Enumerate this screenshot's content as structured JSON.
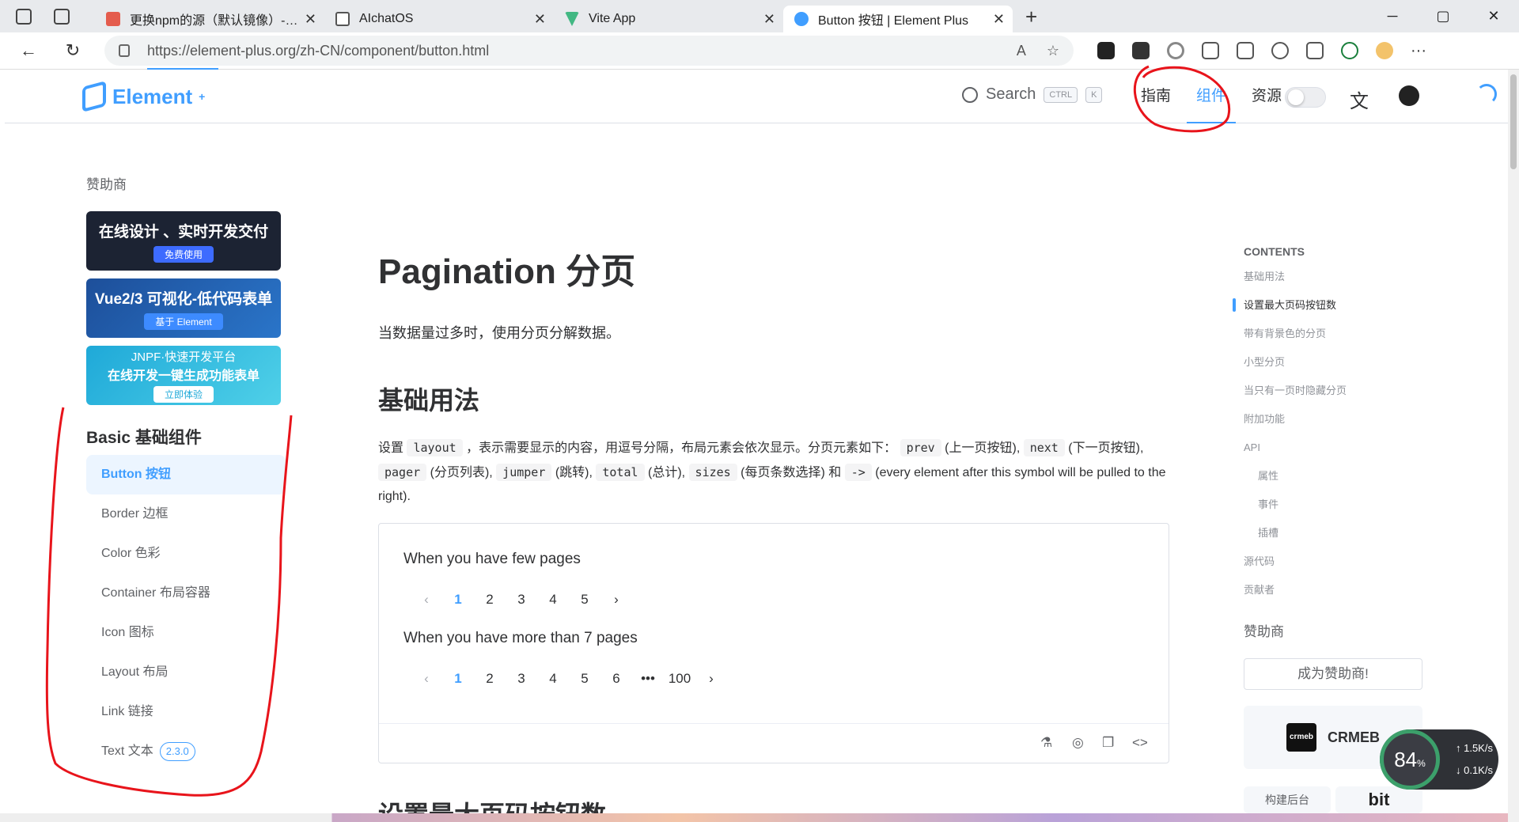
{
  "browser": {
    "tabs": [
      {
        "title": "更换npm的源（默认镜像）- 简书",
        "color": "#e45c4d"
      },
      {
        "title": "AIchatOS",
        "color": "#9aa0a6"
      },
      {
        "title": "Vite App",
        "color": "#42b883"
      },
      {
        "title": "Button 按钮 | Element Plus",
        "color": "#409eff"
      }
    ],
    "url": "https://element-plus.org/zh-CN/component/button.html",
    "win_min": "─",
    "win_max": "▢",
    "win_close": "✕"
  },
  "header": {
    "logo": "Element",
    "logo_sup": "+",
    "search_label": "Search",
    "kbd_ctrl": "CTRL",
    "kbd_k": "K",
    "nav": [
      "指南",
      "组件",
      "资源"
    ],
    "active_nav": "组件"
  },
  "sidebar": {
    "sponsor_title": "赞助商",
    "banners": [
      {
        "title": "在线设计 、实时开发交付",
        "sub": "免费使用",
        "bg": "#1c2333"
      },
      {
        "title": "Vue2/3 可视化-低代码表单",
        "sub": "基于 Element",
        "bg": "#1d4f9a"
      },
      {
        "title": "在线开发一键生成功能表单",
        "sub": "立即体验",
        "bg": "#1fa9d8",
        "top": "JNPF·快速开发平台"
      }
    ],
    "group_title": "Basic 基础组件",
    "items": [
      "Button 按钮",
      "Border 边框",
      "Color 色彩",
      "Container 布局容器",
      "Icon 图标",
      "Layout 布局",
      "Link 链接",
      "Text 文本"
    ],
    "text_badge": "2.3.0"
  },
  "main": {
    "title": "Pagination 分页",
    "intro": "当数据量过多时，使用分页分解数据。",
    "h2": "基础用法",
    "desc": {
      "p1": "设置",
      "c_layout": "layout",
      "p2": "，表示需要显示的内容，用逗号分隔，布局元素会依次显示。分页元素如下：",
      "c_prev": "prev",
      "p3": "(上一页按钮),",
      "c_next": "next",
      "p4": "(下一页按钮),",
      "c_pager": "pager",
      "p5": "(分页列表),",
      "c_jumper": "jumper",
      "p6": "(跳转),",
      "c_total": "total",
      "p7": "(总计),",
      "c_sizes": "sizes",
      "p8": "(每页条数选择) 和",
      "c_arrow": "->",
      "p9": "(every element after this symbol will be pulled to the right)."
    },
    "demo1_title": "When you have few pages",
    "demo1_pages": [
      "1",
      "2",
      "3",
      "4",
      "5"
    ],
    "demo2_title": "When you have more than 7 pages",
    "demo2_pages": [
      "1",
      "2",
      "3",
      "4",
      "5",
      "6",
      "•••",
      "100"
    ],
    "next_h2": "设置最大页码按钮数"
  },
  "toc": {
    "heading": "CONTENTS",
    "items": [
      "基础用法",
      "设置最大页码按钮数",
      "带有背景色的分页",
      "小型分页",
      "当只有一页时隐藏分页",
      "附加功能",
      "API",
      "属性",
      "事件",
      "插槽",
      "源代码",
      "贡献者"
    ],
    "active": "设置最大页码按钮数",
    "sponsor_title": "赞助商",
    "become_sponsor": "成为赞助商!",
    "crmeb": "CRMEB",
    "crmeb_logo": "crmeb",
    "sp1": "构建后台",
    "sp2": "bit"
  },
  "net": {
    "percent": "84",
    "pct_sign": "%",
    "up": "↑ 1.5K/s",
    "down": "↓ 0.1K/s"
  },
  "colors": {
    "accent": "#409eff",
    "annotation": "#e8141b"
  }
}
